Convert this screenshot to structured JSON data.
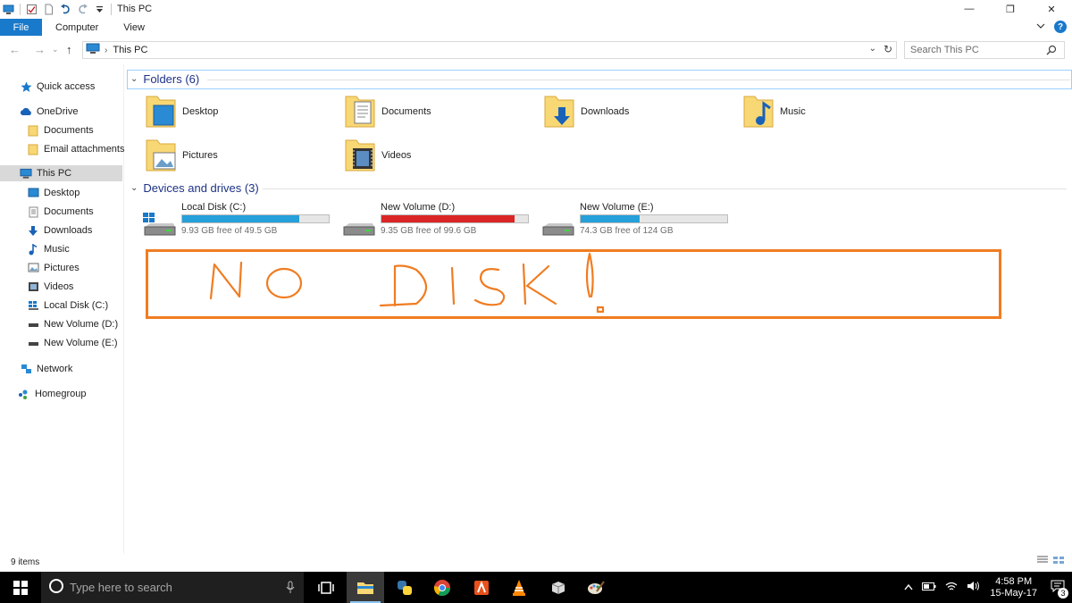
{
  "window": {
    "title": "This PC",
    "controls": {
      "minimize": "—",
      "maximize": "❐",
      "close": "✕"
    }
  },
  "ribbon": {
    "tabs": [
      "File",
      "Computer",
      "View"
    ],
    "help": "?"
  },
  "address_bar": {
    "breadcrumb": "This PC",
    "search_placeholder": "Search This PC"
  },
  "nav_pane": {
    "items": [
      {
        "label": "Quick access",
        "icon": "star-icon"
      },
      {
        "label": "OneDrive",
        "icon": "cloud-icon"
      },
      {
        "label": "Documents",
        "icon": "folder-icon"
      },
      {
        "label": "Email attachments",
        "icon": "folder-icon"
      },
      {
        "label": "This PC",
        "icon": "computer-icon",
        "selected": true
      },
      {
        "label": "Desktop",
        "icon": "desktop-folder-icon"
      },
      {
        "label": "Documents",
        "icon": "documents-icon"
      },
      {
        "label": "Downloads",
        "icon": "download-arrow-icon"
      },
      {
        "label": "Music",
        "icon": "music-note-icon"
      },
      {
        "label": "Pictures",
        "icon": "pictures-icon"
      },
      {
        "label": "Videos",
        "icon": "videos-icon"
      },
      {
        "label": "Local Disk (C:)",
        "icon": "windows-drive-icon"
      },
      {
        "label": "New Volume (D:)",
        "icon": "drive-icon"
      },
      {
        "label": "New Volume (E:)",
        "icon": "drive-icon"
      },
      {
        "label": "Network",
        "icon": "network-icon"
      },
      {
        "label": "Homegroup",
        "icon": "homegroup-icon"
      }
    ]
  },
  "folders_group": {
    "header": "Folders (6)",
    "items": [
      {
        "label": "Desktop",
        "icon": "desktop-folder-icon"
      },
      {
        "label": "Documents",
        "icon": "documents-folder-icon"
      },
      {
        "label": "Downloads",
        "icon": "downloads-folder-icon"
      },
      {
        "label": "Music",
        "icon": "music-folder-icon"
      },
      {
        "label": "Pictures",
        "icon": "pictures-folder-icon"
      },
      {
        "label": "Videos",
        "icon": "videos-folder-icon"
      }
    ]
  },
  "drives_group": {
    "header": "Devices and drives (3)",
    "items": [
      {
        "label": "Local Disk (C:)",
        "free": "9.93 GB free of 49.5 GB",
        "used_fraction": 0.8,
        "bar_color": "#26a0da"
      },
      {
        "label": "New Volume (D:)",
        "free": "9.35 GB free of 99.6 GB",
        "used_fraction": 0.906,
        "bar_color": "#da2626"
      },
      {
        "label": "New Volume (E:)",
        "free": "74.3 GB free of 124 GB",
        "used_fraction": 0.401,
        "bar_color": "#26a0da"
      }
    ]
  },
  "annotation": {
    "text": "NO DISK!",
    "color": "#f07c21"
  },
  "status_bar": {
    "item_count": "9 items"
  },
  "taskbar": {
    "search_placeholder": "Type here to search",
    "apps": [
      "task-view-icon",
      "file-explorer-icon",
      "python-icon",
      "chrome-icon",
      "adobe-icon",
      "vlc-icon",
      "package-icon",
      "paint-icon"
    ],
    "time": "4:58 PM",
    "date": "15-May-17",
    "notifications": "3"
  }
}
